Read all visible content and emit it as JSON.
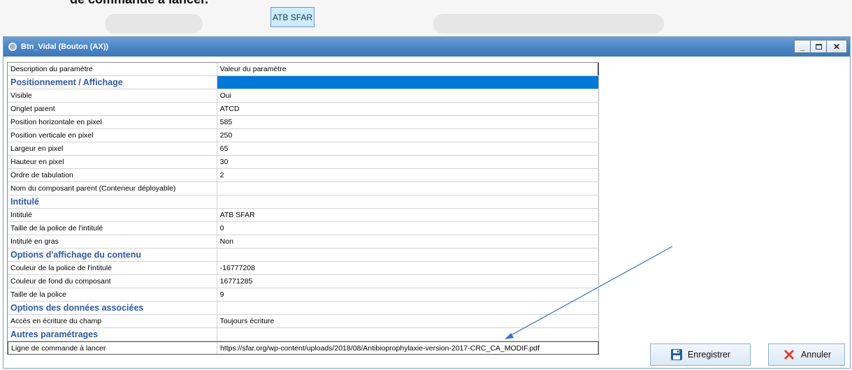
{
  "document": {
    "heading": "de commande à lancer.",
    "preview_button_label": "ATB SFAR"
  },
  "window": {
    "title": "Btn_Vidal (Bouton (AX))",
    "controls": {
      "minimize": "_",
      "close": "✕"
    }
  },
  "grid": {
    "header": {
      "description": "Description du paramètre",
      "value": "Valeur du paramètre"
    },
    "rows": [
      {
        "type": "section",
        "label": "Positionnement / Affichage",
        "value": ""
      },
      {
        "type": "param",
        "label": "Visible",
        "value": "Oui"
      },
      {
        "type": "param",
        "label": "Onglet parent",
        "value": "ATCD"
      },
      {
        "type": "param",
        "label": "Position horizontale en pixel",
        "value": "585"
      },
      {
        "type": "param",
        "label": "Position verticale en pixel",
        "value": "250"
      },
      {
        "type": "param",
        "label": "Largeur en pixel",
        "value": "65"
      },
      {
        "type": "param",
        "label": "Hauteur en pixel",
        "value": "30"
      },
      {
        "type": "param",
        "label": "Ordre de tabulation",
        "value": "2"
      },
      {
        "type": "param",
        "label": "Nom du composant parent (Conteneur déployable)",
        "value": ""
      },
      {
        "type": "section",
        "label": "Intitulé",
        "value": ""
      },
      {
        "type": "param",
        "label": "Intitulé",
        "value": "ATB SFAR"
      },
      {
        "type": "param",
        "label": "Taille de la police de l'intitulé",
        "value": "0"
      },
      {
        "type": "param",
        "label": "Intitulé en gras",
        "value": "Non"
      },
      {
        "type": "section",
        "label": "Options d'affichage du contenu",
        "value": ""
      },
      {
        "type": "param",
        "label": "Couleur de la police de l'intitulé",
        "value": "-16777208"
      },
      {
        "type": "param",
        "label": "Couleur de fond du composant",
        "value": "16771285"
      },
      {
        "type": "param",
        "label": "Taille de la police",
        "value": "9"
      },
      {
        "type": "section",
        "label": "Options des données associées",
        "value": ""
      },
      {
        "type": "param",
        "label": "Accès en écriture du champ",
        "value": "Toujours écriture"
      },
      {
        "type": "section",
        "label": "Autres paramétrages",
        "value": ""
      },
      {
        "type": "param",
        "label": "Ligne de commande à lancer",
        "value": "https://sfar.org/wp-content/uploads/2018/08/Antibioprophylaxie-version-2017-CRC_CA_MODIF.pdf"
      }
    ]
  },
  "buttons": {
    "save": {
      "label": "Enregistrer",
      "icon": "floppy-disk-icon"
    },
    "cancel": {
      "label": "Annuler",
      "icon": "red-x-icon"
    }
  },
  "colors": {
    "section_text": "#2e5aa0",
    "selection": "#0078d7",
    "titlebar": "#4a84c4",
    "cancel_icon": "#e53a2a"
  }
}
